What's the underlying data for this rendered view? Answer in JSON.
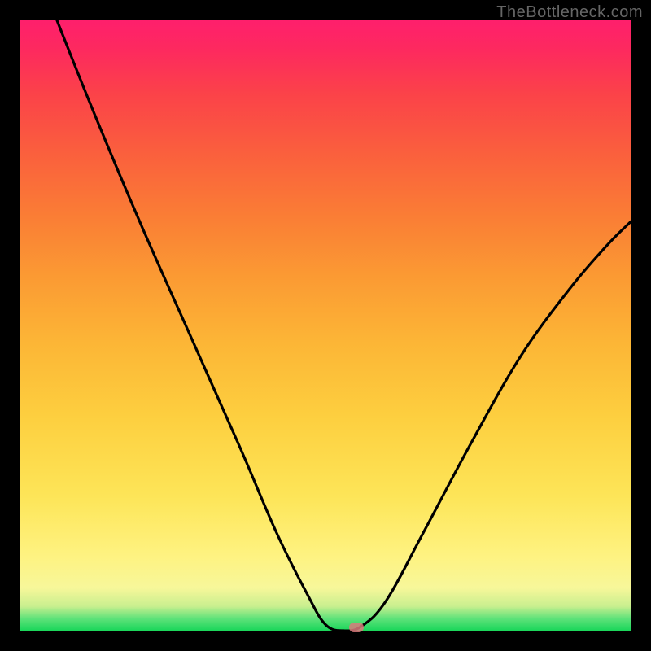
{
  "watermark": "TheBottleneck.com",
  "chart_data": {
    "type": "line",
    "title": "",
    "xlabel": "",
    "ylabel": "",
    "xlim": [
      0,
      100
    ],
    "ylim": [
      0,
      100
    ],
    "grid": false,
    "legend": false,
    "background": "heat-gradient-green-to-red",
    "curve_points": [
      {
        "x": 6,
        "y": 100
      },
      {
        "x": 12,
        "y": 85
      },
      {
        "x": 20,
        "y": 66
      },
      {
        "x": 28,
        "y": 48
      },
      {
        "x": 36,
        "y": 30
      },
      {
        "x": 42,
        "y": 16
      },
      {
        "x": 47,
        "y": 6
      },
      {
        "x": 50,
        "y": 1
      },
      {
        "x": 53,
        "y": 0
      },
      {
        "x": 56,
        "y": 0.8
      },
      {
        "x": 60,
        "y": 5
      },
      {
        "x": 66,
        "y": 16
      },
      {
        "x": 74,
        "y": 31
      },
      {
        "x": 82,
        "y": 45
      },
      {
        "x": 90,
        "y": 56
      },
      {
        "x": 96,
        "y": 63
      },
      {
        "x": 100,
        "y": 67
      }
    ],
    "marker": {
      "x": 55,
      "y": 0.5
    },
    "colors": {
      "curve": "#000000",
      "marker": "#d97a7d",
      "frame": "#000000"
    }
  }
}
